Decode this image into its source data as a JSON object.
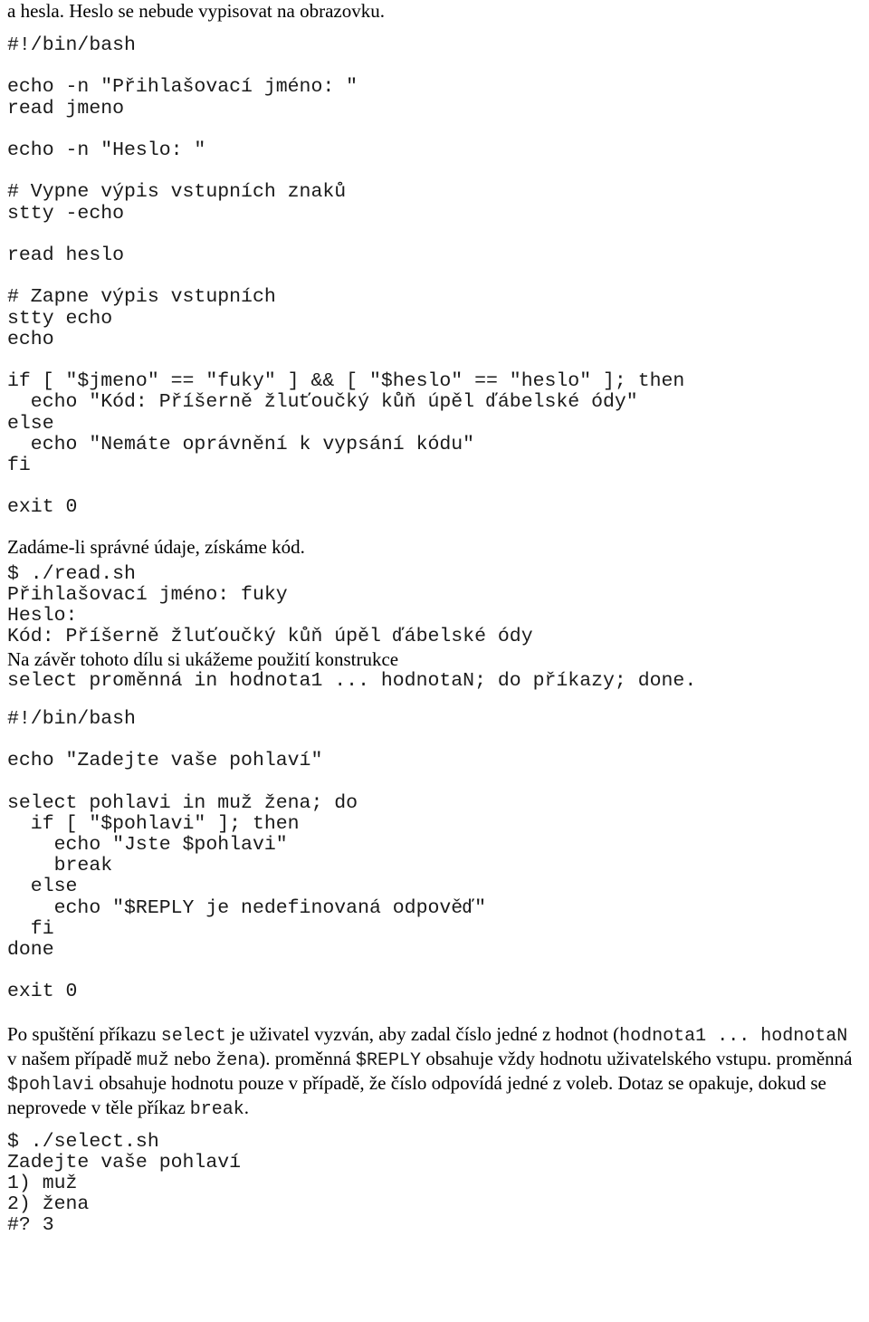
{
  "document": {
    "intro_line": "a hesla. Heslo se nebude vypisovat na obrazovku.",
    "script_read": {
      "lines": [
        "#!/bin/bash",
        "",
        "echo -n \"Přihlašovací jméno: \"",
        "read jmeno",
        "",
        "echo -n \"Heslo: \"",
        "",
        "# Vypne výpis vstupních znaků",
        "stty -echo",
        "",
        "read heslo",
        "",
        "# Zapne výpis vstupních",
        "stty echo",
        "echo",
        "",
        "if [ \"$jmeno\" == \"fuky\" ] && [ \"$heslo\" == \"heslo\" ]; then",
        "  echo \"Kód: Příšerně žluťoučký kůň úpěl ďábelské ódy\"",
        "else",
        "  echo \"Nemáte oprávnění k vypsání kódu\"",
        "fi",
        "",
        "exit 0"
      ]
    },
    "caption_read_result": "Zadáme-li správné údaje, získáme kód.",
    "terminal_read": {
      "lines": [
        "$ ./read.sh",
        "Přihlašovací jméno: fuky",
        "Heslo:",
        "Kód: Příšerně žluťoučký kůň úpěl ďábelské ódy"
      ]
    },
    "caption_select_intro": "Na závěr tohoto dílu si ukážeme použití konstrukce",
    "select_syntax": "select proměnná in hodnota1 ... hodnotaN; do příkazy; done.",
    "script_select": {
      "lines": [
        "#!/bin/bash",
        "",
        "echo \"Zadejte vaše pohlaví\"",
        "",
        "select pohlavi in muž žena; do",
        "  if [ \"$pohlavi\" ]; then",
        "    echo \"Jste $pohlavi\"",
        "    break",
        "  else",
        "    echo \"$REPLY je nedefinovaná odpověď\"",
        "  fi",
        "done",
        "",
        "exit 0"
      ]
    },
    "paragraph_select": {
      "part1": "Po spuštění příkazu ",
      "mono1": "select",
      "part2": " je uživatel vyzván, aby zadal číslo jedné z hodnot (",
      "mono2": "hodnota1 ... hodnotaN",
      "part3": " v našem případě ",
      "mono3": "muž",
      "part4": " nebo ",
      "mono4": "žena",
      "part5": "). proměnná ",
      "mono5": "$REPLY",
      "part6": " obsahuje vždy hodnotu uživatelského vstupu. proměnná ",
      "mono6": "$pohlavi",
      "part7": " obsahuje hodnotu pouze v případě, že číslo odpovídá jedné z voleb. Dotaz se opakuje, dokud se neprovede v těle příkaz ",
      "mono7": "break",
      "part8": "."
    },
    "terminal_select": {
      "lines": [
        "$ ./select.sh",
        "Zadejte vaše pohlaví",
        "1) muž",
        "2) žena",
        "#? 3"
      ]
    }
  }
}
